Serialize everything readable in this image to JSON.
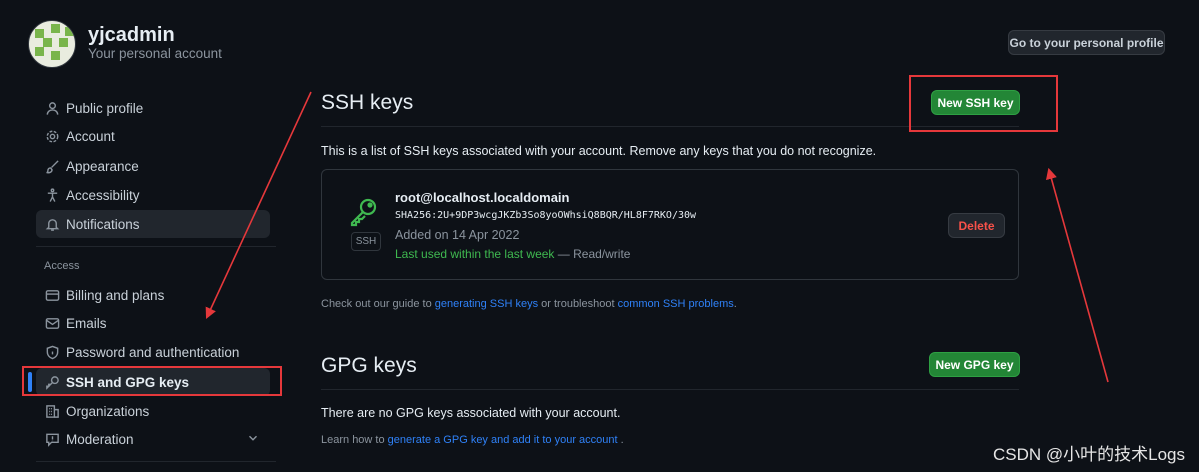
{
  "header": {
    "username": "yjcadmin",
    "subtitle": "Your personal account",
    "profile_button": "Go to your personal profile"
  },
  "sidebar": {
    "items": [
      {
        "label": "Public profile",
        "icon": "person-icon"
      },
      {
        "label": "Account",
        "icon": "gear-icon"
      },
      {
        "label": "Appearance",
        "icon": "paintbrush-icon"
      },
      {
        "label": "Accessibility",
        "icon": "accessibility-icon"
      },
      {
        "label": "Notifications",
        "icon": "bell-icon"
      }
    ],
    "group_label": "Access",
    "access_items": [
      {
        "label": "Billing and plans",
        "icon": "credit-card-icon"
      },
      {
        "label": "Emails",
        "icon": "mail-icon"
      },
      {
        "label": "Password and authentication",
        "icon": "shield-lock-icon"
      },
      {
        "label": "SSH and GPG keys",
        "icon": "key-icon"
      },
      {
        "label": "Organizations",
        "icon": "organization-icon"
      },
      {
        "label": "Moderation",
        "icon": "report-icon"
      }
    ]
  },
  "ssh": {
    "title": "SSH keys",
    "new_button": "New SSH key",
    "description": "This is a list of SSH keys associated with your account. Remove any keys that you do not recognize.",
    "key": {
      "name": "root@localhost.localdomain",
      "fingerprint": "SHA256:2U+9DP3wcgJKZb3So8yoOWhsiQ8BQR/HL8F7RKO/30w",
      "added": "Added on 14 Apr 2022",
      "last_used": "Last used within the last week",
      "access": "— Read/write",
      "badge": "SSH",
      "delete_button": "Delete"
    },
    "guide_prefix": "Check out our guide to ",
    "guide_link1": "generating SSH keys",
    "guide_middle": " or troubleshoot ",
    "guide_link2": "common SSH problems",
    "guide_suffix": "."
  },
  "gpg": {
    "title": "GPG keys",
    "new_button": "New GPG key",
    "empty": "There are no GPG keys associated with your account.",
    "learn_prefix": "Learn how to ",
    "learn_link": "generate a GPG key and add it to your account",
    "learn_suffix": " ."
  },
  "watermark": "CSDN @小叶的技术Logs",
  "colors": {
    "accent": "#2f81f7",
    "green": "#238636",
    "danger": "#f85149",
    "annotation": "#e5383b"
  }
}
